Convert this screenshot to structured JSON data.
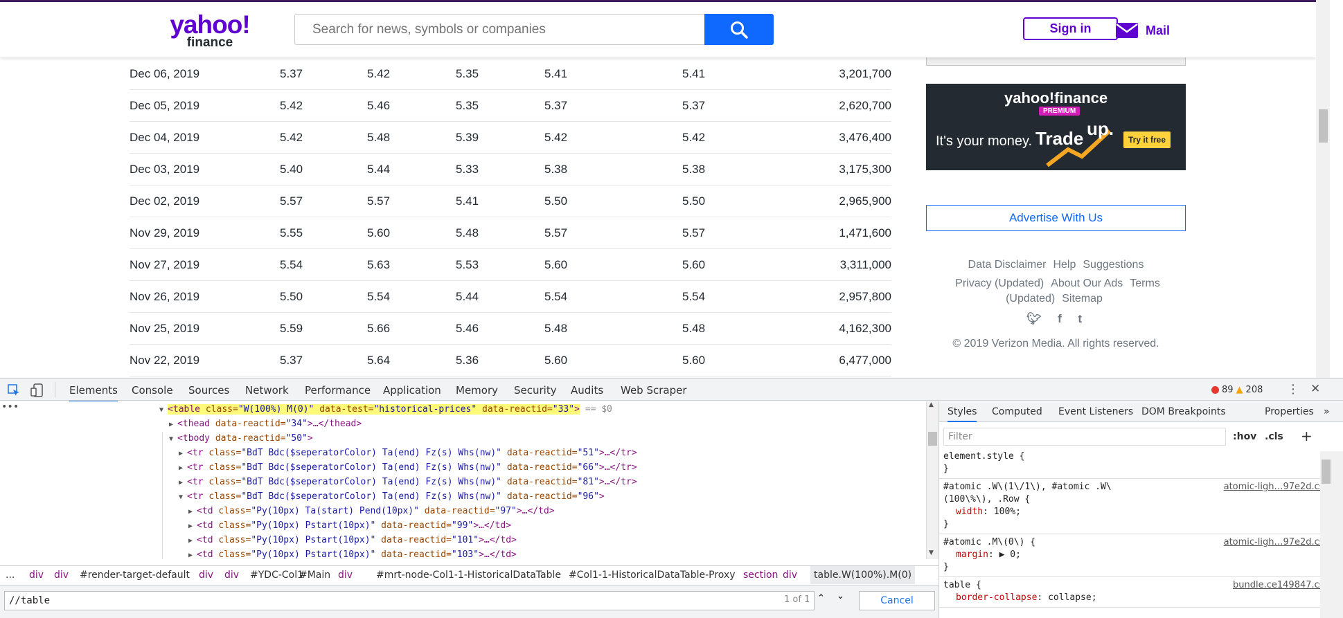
{
  "header": {
    "logo_line1": "yahoo!",
    "logo_line2": "finance",
    "search_placeholder": "Search for news, symbols or companies",
    "signin_label": "Sign in",
    "mail_label": "Mail"
  },
  "table": {
    "rows": [
      [
        "Dec 06, 2019",
        "5.37",
        "5.42",
        "5.35",
        "5.41",
        "5.41",
        "3,201,700"
      ],
      [
        "Dec 05, 2019",
        "5.42",
        "5.46",
        "5.35",
        "5.37",
        "5.37",
        "2,620,700"
      ],
      [
        "Dec 04, 2019",
        "5.42",
        "5.48",
        "5.39",
        "5.42",
        "5.42",
        "3,476,400"
      ],
      [
        "Dec 03, 2019",
        "5.40",
        "5.44",
        "5.33",
        "5.38",
        "5.38",
        "3,175,300"
      ],
      [
        "Dec 02, 2019",
        "5.57",
        "5.57",
        "5.41",
        "5.50",
        "5.50",
        "2,965,900"
      ],
      [
        "Nov 29, 2019",
        "5.55",
        "5.60",
        "5.48",
        "5.57",
        "5.57",
        "1,471,600"
      ],
      [
        "Nov 27, 2019",
        "5.54",
        "5.63",
        "5.53",
        "5.60",
        "5.60",
        "3,311,000"
      ],
      [
        "Nov 26, 2019",
        "5.50",
        "5.54",
        "5.44",
        "5.54",
        "5.54",
        "2,957,800"
      ],
      [
        "Nov 25, 2019",
        "5.59",
        "5.66",
        "5.46",
        "5.48",
        "5.48",
        "4,162,300"
      ],
      [
        "Nov 22, 2019",
        "5.37",
        "5.64",
        "5.36",
        "5.60",
        "5.60",
        "6,477,000"
      ]
    ]
  },
  "sidebar": {
    "ad_brand": "yahoo!finance",
    "ad_premium": "PREMIUM",
    "ad_money": "It's your money.",
    "ad_trade": "Trade",
    "ad_up": "up.",
    "ad_try": "Try it free",
    "advertise_label": "Advertise With Us",
    "links": [
      "Data Disclaimer",
      "Help",
      "Suggestions",
      "Privacy (Updated)",
      "About Our Ads",
      "Terms (Updated)",
      "Sitemap"
    ],
    "copyright": "© 2019 Verizon Media. All rights reserved."
  },
  "devtools": {
    "tabs": [
      "Elements",
      "Console",
      "Sources",
      "Network",
      "Performance",
      "Application",
      "Memory",
      "Security",
      "Audits",
      "Web Scraper"
    ],
    "error_count": "89",
    "warning_count": "208",
    "dom_lines": [
      {
        "indent": 0,
        "arrow": "▼",
        "tag": "table",
        "attrs": [
          [
            "class",
            "W(100%) M(0)"
          ],
          [
            "data-test",
            "historical-prices"
          ],
          [
            "data-reactid",
            "33"
          ]
        ],
        "tail": "> == $0"
      },
      {
        "indent": 1,
        "arrow": "▶",
        "tag": "thead",
        "attrs": [
          [
            "data-reactid",
            "34"
          ]
        ],
        "tail": ">…</thead>"
      },
      {
        "indent": 1,
        "arrow": "▼",
        "tag": "tbody",
        "attrs": [
          [
            "data-reactid",
            "50"
          ]
        ],
        "tail": ">"
      },
      {
        "indent": 2,
        "arrow": "▶",
        "tag": "tr",
        "attrs": [
          [
            "class",
            "BdT Bdc($seperatorColor) Ta(end) Fz(s) Whs(nw)"
          ],
          [
            "data-reactid",
            "51"
          ]
        ],
        "tail": ">…</tr>"
      },
      {
        "indent": 2,
        "arrow": "▶",
        "tag": "tr",
        "attrs": [
          [
            "class",
            "BdT Bdc($seperatorColor) Ta(end) Fz(s) Whs(nw)"
          ],
          [
            "data-reactid",
            "66"
          ]
        ],
        "tail": ">…</tr>"
      },
      {
        "indent": 2,
        "arrow": "▶",
        "tag": "tr",
        "attrs": [
          [
            "class",
            "BdT Bdc($seperatorColor) Ta(end) Fz(s) Whs(nw)"
          ],
          [
            "data-reactid",
            "81"
          ]
        ],
        "tail": ">…</tr>"
      },
      {
        "indent": 2,
        "arrow": "▼",
        "tag": "tr",
        "attrs": [
          [
            "class",
            "BdT Bdc($seperatorColor) Ta(end) Fz(s) Whs(nw)"
          ],
          [
            "data-reactid",
            "96"
          ]
        ],
        "tail": ">"
      },
      {
        "indent": 3,
        "arrow": "▶",
        "tag": "td",
        "attrs": [
          [
            "class",
            "Py(10px) Ta(start) Pend(10px)"
          ],
          [
            "data-reactid",
            "97"
          ]
        ],
        "tail": ">…</td>"
      },
      {
        "indent": 3,
        "arrow": "▶",
        "tag": "td",
        "attrs": [
          [
            "class",
            "Py(10px) Pstart(10px)"
          ],
          [
            "data-reactid",
            "99"
          ]
        ],
        "tail": ">…</td>"
      },
      {
        "indent": 3,
        "arrow": "▶",
        "tag": "td",
        "attrs": [
          [
            "class",
            "Py(10px) Pstart(10px)"
          ],
          [
            "data-reactid",
            "101"
          ]
        ],
        "tail": ">…</td>"
      },
      {
        "indent": 3,
        "arrow": "▶",
        "tag": "td",
        "attrs": [
          [
            "class",
            "Py(10px) Pstart(10px)"
          ],
          [
            "data-reactid",
            "103"
          ]
        ],
        "tail": ">…</td>"
      }
    ],
    "breadcrumbs": [
      "...",
      "div",
      "div",
      "#render-target-default",
      "div",
      "div",
      "#YDC-Col1",
      "#Main",
      "div",
      "#mrt-node-Col1-1-HistoricalDataTable",
      "#Col1-1-HistoricalDataTable-Proxy",
      "section",
      "div",
      "table.W(100%).M(0)"
    ],
    "find_value": "//table",
    "find_count": "1 of 1",
    "cancel_label": "Cancel",
    "styles_tabs": [
      "Styles",
      "Computed",
      "Event Listeners",
      "DOM Breakpoints",
      "Properties"
    ],
    "filter_placeholder": "Filter",
    "hov": ":hov",
    "cls": ".cls",
    "rules": [
      {
        "selector": "element.style {",
        "lines": [],
        "close": "}",
        "source": ""
      },
      {
        "selector": "#atomic .W\\(1\\/1\\), #atomic .W\\",
        "selector2": "(100\\%\\), .Row {",
        "lines": [
          [
            "width",
            "100%"
          ]
        ],
        "close": "}",
        "source": "atomic-ligh…97e2d.css:1"
      },
      {
        "selector": "#atomic .M\\(0\\) {",
        "lines": [
          [
            "margin",
            "▶ 0"
          ]
        ],
        "close": "}",
        "source": "atomic-ligh…97e2d.css:1"
      },
      {
        "selector": "table {",
        "lines": [
          [
            "border-collapse",
            "collapse"
          ]
        ],
        "close": "",
        "source": "bundle.ce149847.css:1"
      }
    ]
  }
}
